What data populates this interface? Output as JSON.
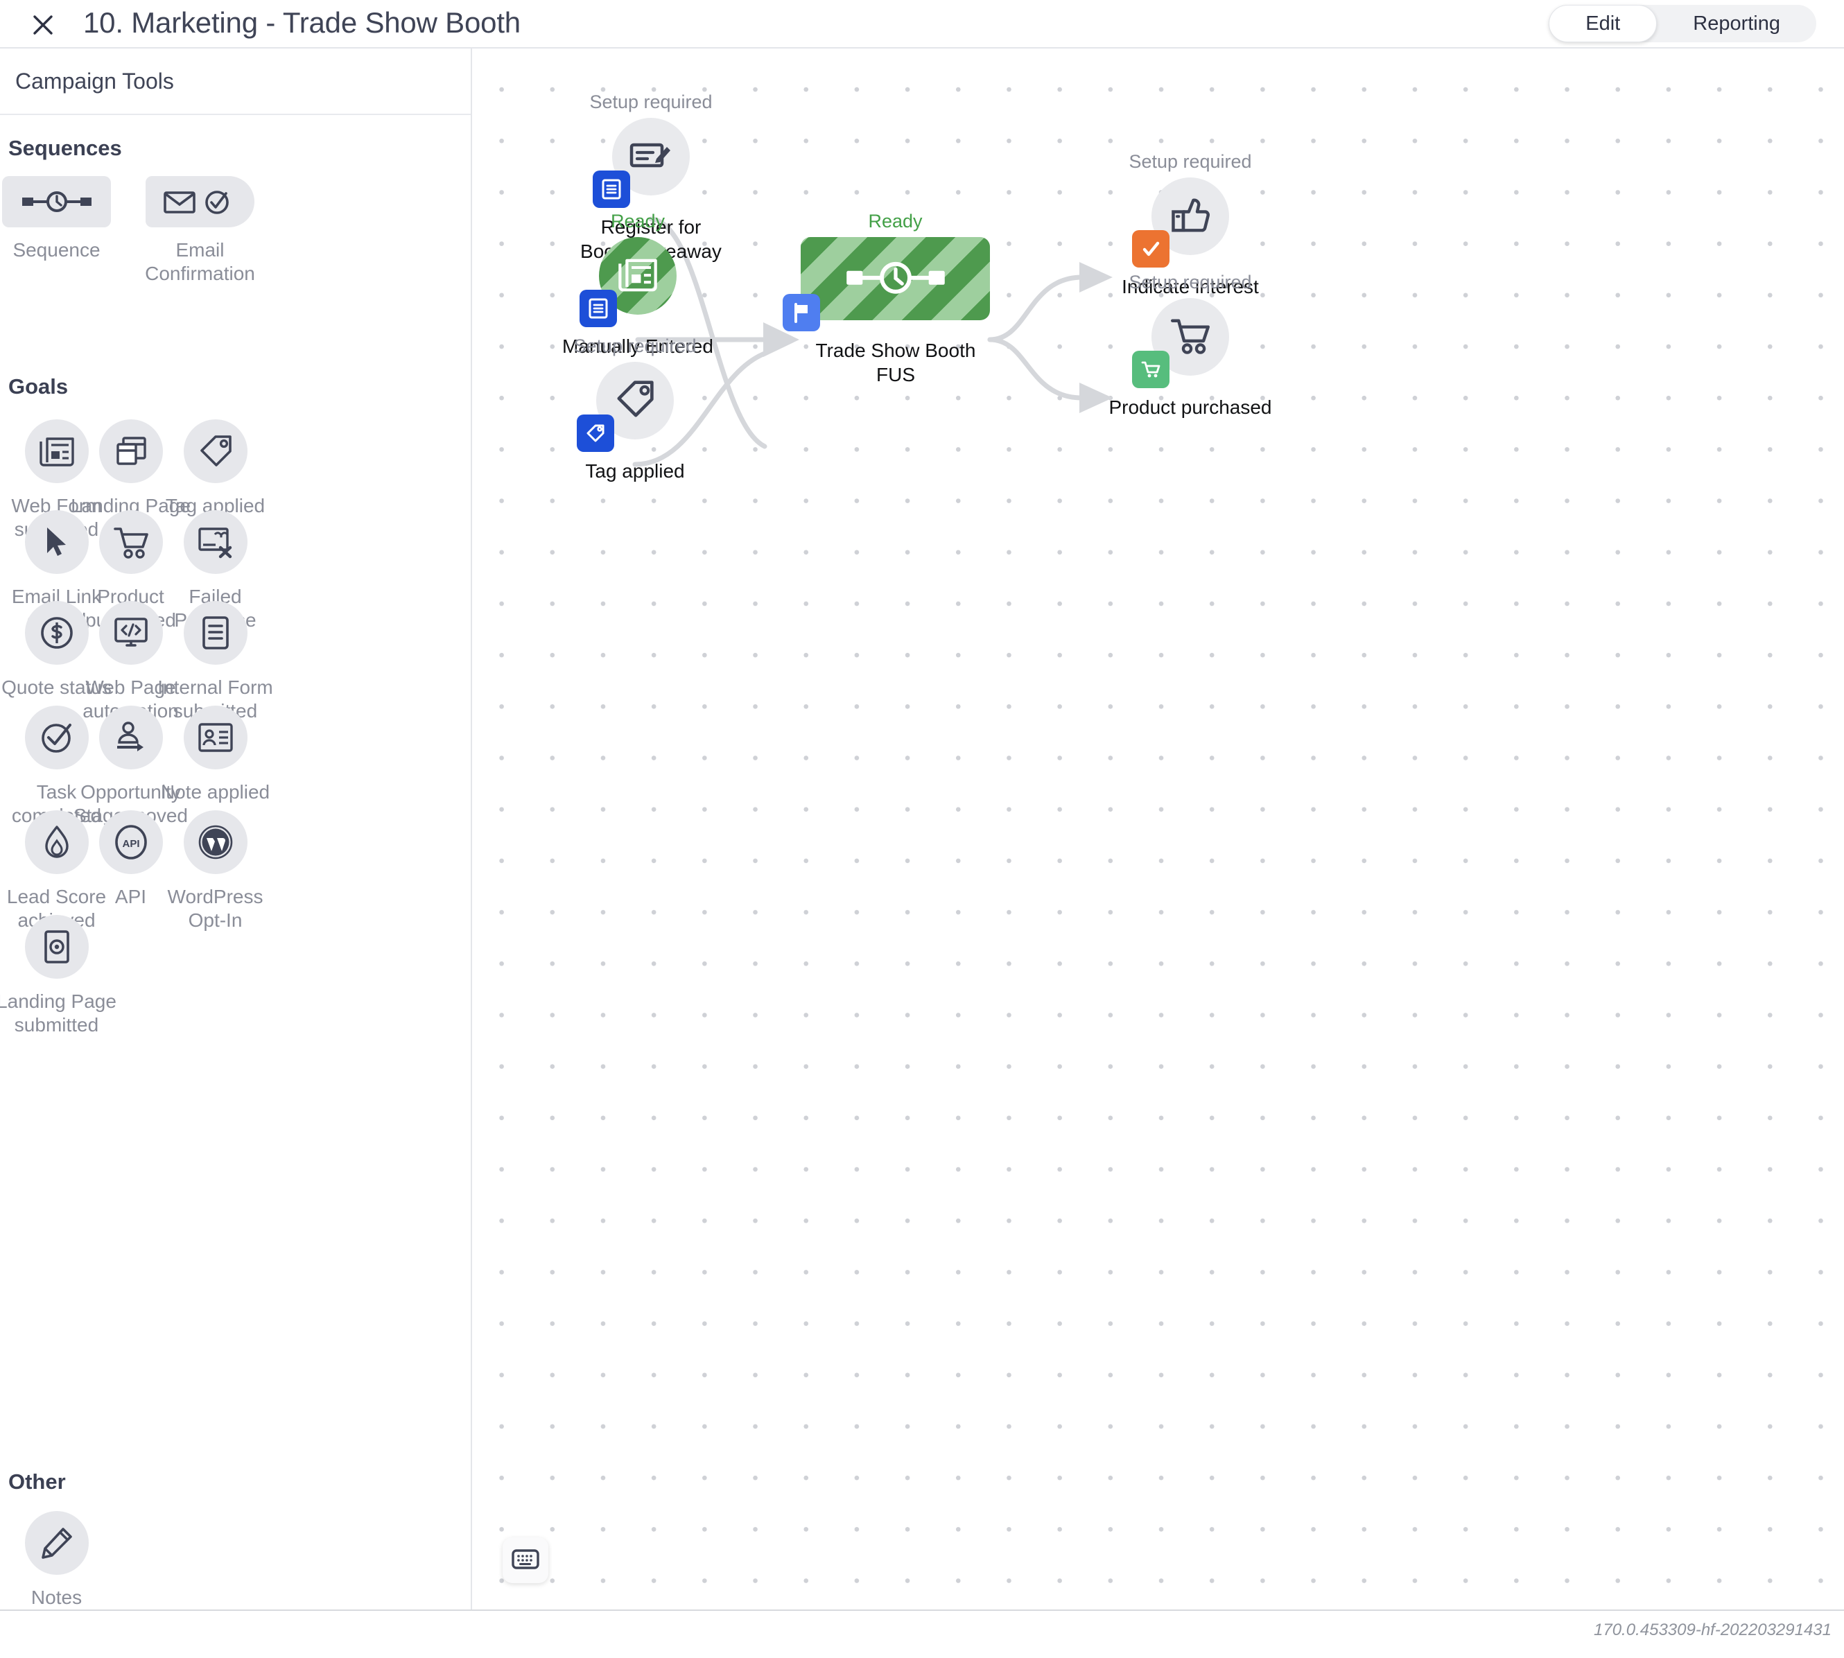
{
  "header": {
    "close_icon": "close-icon",
    "title": "10. Marketing - Trade Show Booth",
    "tabs": [
      {
        "label": "Edit",
        "active": true
      },
      {
        "label": "Reporting",
        "active": false
      }
    ]
  },
  "sidebar": {
    "title": "Campaign Tools",
    "sections": [
      {
        "heading": "Sequences",
        "items": [
          {
            "label": "Sequence",
            "icon": "sequence-timeline-icon",
            "shape": "rect"
          },
          {
            "label": "Email\nConfirmation",
            "icon": "email-confirmation-icon",
            "shape": "pill"
          }
        ]
      },
      {
        "heading": "Goals",
        "items": [
          {
            "label": "Web Form\nsubmitted",
            "icon": "web-form-icon",
            "shape": "circle"
          },
          {
            "label": "Landing\nPage",
            "icon": "landing-page-icon",
            "shape": "circle"
          },
          {
            "label": "Tag applied",
            "icon": "tag-icon",
            "shape": "circle"
          },
          {
            "label": "Email Link\nclicked",
            "icon": "cursor-click-icon",
            "shape": "circle"
          },
          {
            "label": "Product\npurchased",
            "icon": "shopping-cart-icon",
            "shape": "circle"
          },
          {
            "label": "Failed\nPurchase",
            "icon": "failed-purchase-icon",
            "shape": "circle"
          },
          {
            "label": "Quote status",
            "icon": "dollar-coin-icon",
            "shape": "circle"
          },
          {
            "label": "Web Page\nautomation",
            "icon": "code-monitor-icon",
            "shape": "circle"
          },
          {
            "label": "Internal\nForm\nsubmitted",
            "icon": "document-lines-icon",
            "shape": "circle"
          },
          {
            "label": "Task\ncompleted",
            "icon": "check-circle-icon",
            "shape": "circle"
          },
          {
            "label": "Opportunity\nStage\nmoved",
            "icon": "person-move-icon",
            "shape": "circle"
          },
          {
            "label": "Note applied",
            "icon": "contact-card-icon",
            "shape": "circle"
          },
          {
            "label": "Lead Score\nachieved",
            "icon": "flame-icon",
            "shape": "circle"
          },
          {
            "label": "API",
            "icon": "api-icon",
            "shape": "circle"
          },
          {
            "label": "WordPress\nOpt-In",
            "icon": "wordpress-icon",
            "shape": "circle"
          },
          {
            "label": "Landing\nPage\nsubmitted",
            "icon": "landing-page-submitted-icon",
            "shape": "circle"
          }
        ]
      },
      {
        "heading": "Other",
        "items": [
          {
            "label": "Notes",
            "icon": "pencil-icon",
            "shape": "circle"
          }
        ]
      }
    ]
  },
  "canvas": {
    "keyboard_button_icon": "keyboard-icon",
    "nodes": [
      {
        "id": "register-booth-giveaway",
        "status": "Setup required",
        "status_state": "setup",
        "label": "Register for\nBooth Giveaway",
        "shape": "circle",
        "icon": "internal-form-icon",
        "badge_icon": "form-badge-icon",
        "badge_color": "#1d4fd8"
      },
      {
        "id": "manually-entered",
        "status": "Ready",
        "status_state": "ready",
        "label": "Manually Entered",
        "shape": "circle-green",
        "icon": "web-form-icon",
        "badge_icon": "form-badge-icon",
        "badge_color": "#1d4fd8"
      },
      {
        "id": "tag-applied",
        "status": "Setup required",
        "status_state": "setup",
        "label": "Tag applied",
        "shape": "circle",
        "icon": "tag-icon",
        "badge_icon": "tag-badge-icon",
        "badge_color": "#1d4fd8"
      },
      {
        "id": "trade-show-booth-fus",
        "status": "Ready",
        "status_state": "ready",
        "label": "Trade Show Booth\nFUS",
        "shape": "rect-green",
        "icon": "sequence-timeline-icon",
        "badge_icon": "flag-badge-icon",
        "badge_color": "#4f7ef0"
      },
      {
        "id": "indicate-interest",
        "status": "Setup required",
        "status_state": "setup",
        "label": "Indicate interest",
        "shape": "circle",
        "icon": "thumbs-up-icon",
        "badge_icon": "check-badge-icon",
        "badge_color": "#ec7331"
      },
      {
        "id": "product-purchased",
        "status": "Setup required",
        "status_state": "setup",
        "label": "Product purchased",
        "shape": "circle",
        "icon": "shopping-cart-icon",
        "badge_icon": "cart-badge-icon",
        "badge_color": "#57bd7d"
      }
    ]
  },
  "footer": {
    "version": "170.0.453309-hf-202203291431"
  },
  "colors": {
    "ready_green": "#43a047",
    "setup_gray": "#8a8d98",
    "badge_blue": "#1d4fd8",
    "badge_orange": "#ec7331",
    "badge_green": "#57bd7d",
    "node_green": "#4e9a4e"
  }
}
